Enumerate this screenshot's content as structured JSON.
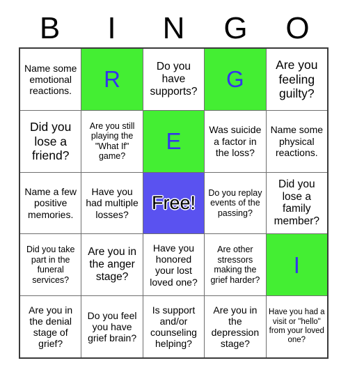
{
  "header": {
    "letters": [
      "B",
      "I",
      "N",
      "G",
      "O"
    ]
  },
  "colors": {
    "marked_background": "#44ee33",
    "marked_text": "#3333ee",
    "free_background": "#5a52f0",
    "free_text": "#000000",
    "free_outline": "#ffffff",
    "cell_background": "#ffffff",
    "cell_text": "#000000",
    "grid_line": "#3a3a3a"
  },
  "grid": {
    "rows": 5,
    "columns": 5,
    "cells": [
      [
        {
          "text": "Name some emotional reactions.",
          "state": "open",
          "size": "md"
        },
        {
          "text": "R",
          "state": "marked",
          "size": "xl"
        },
        {
          "text": "Do you have supports?",
          "state": "open",
          "size": "lg"
        },
        {
          "text": "G",
          "state": "marked",
          "size": "xl"
        },
        {
          "text": "Are you feeling guilty?",
          "state": "open",
          "size": "xl"
        }
      ],
      [
        {
          "text": "Did you lose a friend?",
          "state": "open",
          "size": "xl"
        },
        {
          "text": "Are you still playing the \"What If\" game?",
          "state": "open",
          "size": "sm"
        },
        {
          "text": "E",
          "state": "marked",
          "size": "xl"
        },
        {
          "text": "Was suicide a factor in the loss?",
          "state": "open",
          "size": "md"
        },
        {
          "text": "Name some physical reactions.",
          "state": "open",
          "size": "md"
        }
      ],
      [
        {
          "text": "Name a few positive memories.",
          "state": "open",
          "size": "md"
        },
        {
          "text": "Have you had multiple losses?",
          "state": "open",
          "size": "md"
        },
        {
          "text": "Free!",
          "state": "free",
          "size": "xl"
        },
        {
          "text": "Do you replay events of the passing?",
          "state": "open",
          "size": "sm"
        },
        {
          "text": "Did you lose a family member?",
          "state": "open",
          "size": "lg"
        }
      ],
      [
        {
          "text": "Did you take part in the funeral services?",
          "state": "open",
          "size": "sm"
        },
        {
          "text": "Are you in the anger stage?",
          "state": "open",
          "size": "lg"
        },
        {
          "text": "Have you honored your lost loved one?",
          "state": "open",
          "size": "md"
        },
        {
          "text": "Are other stressors making the grief harder?",
          "state": "open",
          "size": "sm"
        },
        {
          "text": "I",
          "state": "marked",
          "size": "xl"
        }
      ],
      [
        {
          "text": "Are you in the denial stage of grief?",
          "state": "open",
          "size": "md"
        },
        {
          "text": "Do you feel you have grief brain?",
          "state": "open",
          "size": "md"
        },
        {
          "text": "Is support and/or counseling helping?",
          "state": "open",
          "size": "md"
        },
        {
          "text": "Are you in the depression stage?",
          "state": "open",
          "size": "md"
        },
        {
          "text": "Have you had a visit or \"hello\" from your loved one?",
          "state": "open",
          "size": "xs"
        }
      ]
    ]
  }
}
